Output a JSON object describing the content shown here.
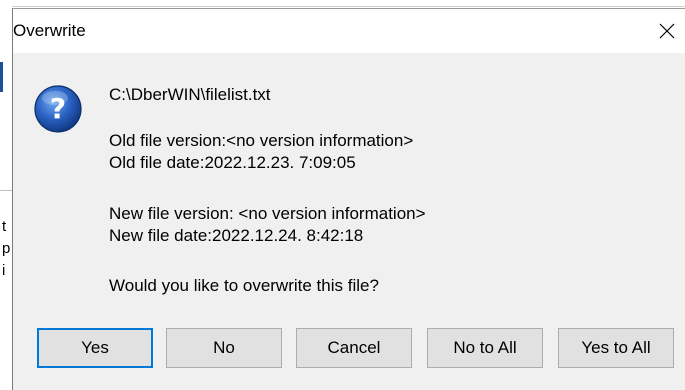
{
  "dialog": {
    "title": "Overwrite",
    "icon": "question-icon",
    "file_path": "C:\\DberWIN\\filelist.txt",
    "old_version": "Old file version:<no version information>",
    "old_date": "Old file date:2022.12.23. 7:09:05",
    "new_version": "New file version: <no version information>",
    "new_date": "New file date:2022.12.24. 8:42:18",
    "question": "Would you like to overwrite this file?"
  },
  "buttons": {
    "yes": "Yes",
    "no": "No",
    "cancel": "Cancel",
    "no_to_all": "No to All",
    "yes_to_all": "Yes to All"
  },
  "background": {
    "fragments": [
      "t",
      "p",
      "i"
    ]
  },
  "colors": {
    "dialog_bg": "#f0f0f0",
    "titlebar_bg": "#ffffff",
    "default_button_border": "#0078d7",
    "button_bg": "#e1e1e1",
    "icon_blue": "#1f5fbf"
  }
}
